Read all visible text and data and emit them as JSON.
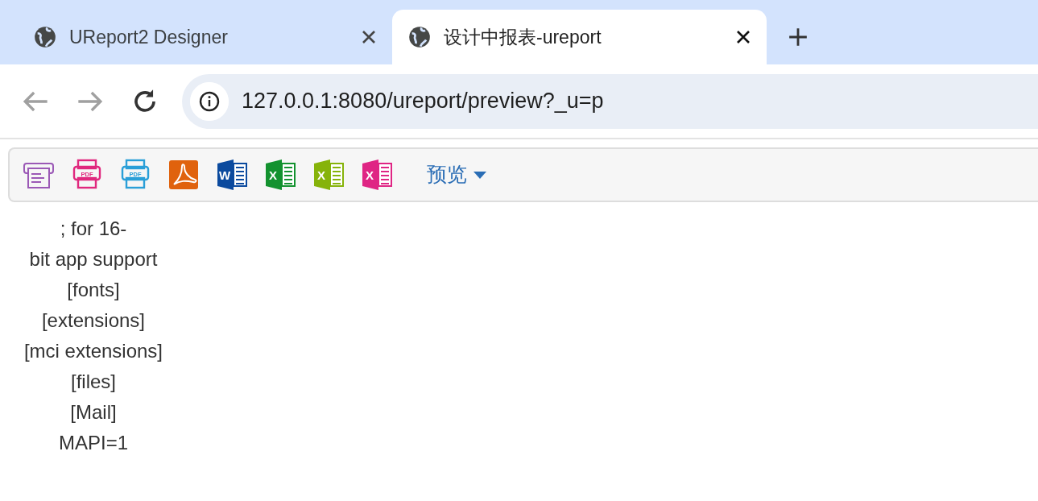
{
  "browser": {
    "tabs": [
      {
        "title": "UReport2 Designer",
        "selected": false
      },
      {
        "title": "设计中报表-ureport",
        "selected": true
      }
    ],
    "address": "127.0.0.1:8080/ureport/preview?_u=p"
  },
  "toolbar": {
    "buttons": [
      {
        "kind": "print",
        "color": "#9b59b6"
      },
      {
        "kind": "pdf-print",
        "color": "#e0287e",
        "label": "PDF"
      },
      {
        "kind": "pdf-print",
        "color": "#2a9fd8",
        "label": "PDF"
      },
      {
        "kind": "pdf",
        "color": "#e0620d"
      },
      {
        "kind": "doc",
        "color": "#0b4a9e",
        "label": "W"
      },
      {
        "kind": "doc",
        "color": "#13922f",
        "label": "X"
      },
      {
        "kind": "doc",
        "color": "#86b30a",
        "label": "X"
      },
      {
        "kind": "doc",
        "color": "#df2584",
        "label": "X"
      }
    ],
    "menu": "预览"
  },
  "report": {
    "lines": [
      "; for 16-",
      "bit app support",
      "[fonts]",
      "[extensions]",
      "[mci extensions]",
      "[files]",
      "[Mail]",
      "MAPI=1"
    ]
  }
}
